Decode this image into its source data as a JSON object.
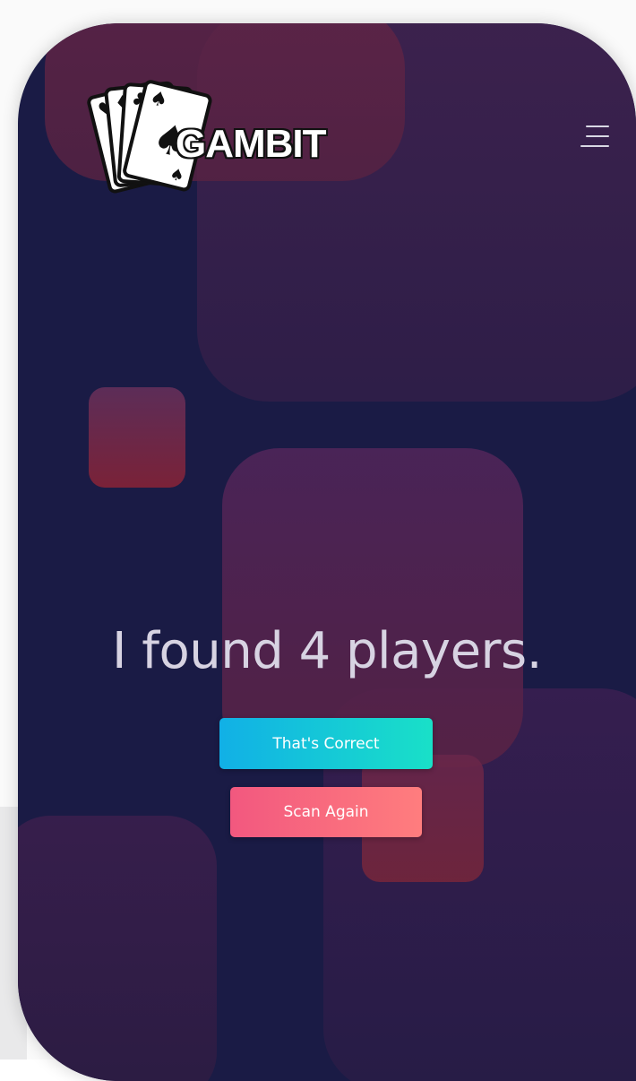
{
  "brand": {
    "name": "GAMBIT",
    "logo_icon": "playing-cards-icon"
  },
  "header": {
    "menu_icon": "hamburger-menu-icon"
  },
  "main": {
    "headline": "I found 4 players.",
    "confirm_label": "That's Correct",
    "rescan_label": "Scan Again"
  },
  "colors": {
    "background": "#1a1b45",
    "confirm_gradient": [
      "#11b0e6",
      "#19e0c8"
    ],
    "rescan_gradient": [
      "#f2587f",
      "#ff7d7e"
    ],
    "headline_text": "#d7d3e2"
  }
}
